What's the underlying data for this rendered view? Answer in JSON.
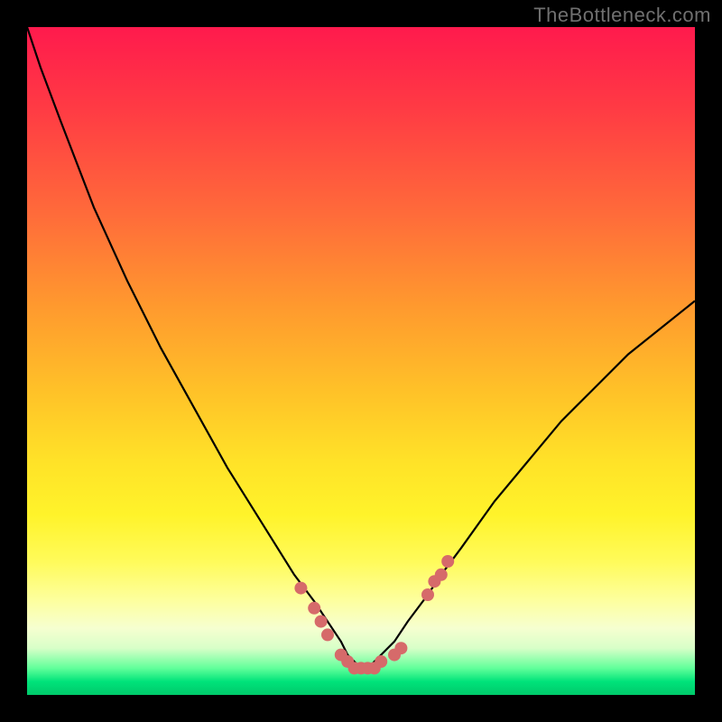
{
  "watermark": "TheBottleneck.com",
  "colors": {
    "frame": "#000000",
    "curve_stroke": "#000000",
    "marker_fill": "#d66a6a",
    "marker_stroke": "#b94d4d",
    "watermark_text": "#707070"
  },
  "chart_data": {
    "type": "line",
    "title": "",
    "xlabel": "",
    "ylabel": "",
    "xlim": [
      0,
      100
    ],
    "ylim": [
      0,
      100
    ],
    "grid": false,
    "series": [
      {
        "name": "bottleneck-curve",
        "x": [
          0,
          2,
          5,
          10,
          15,
          20,
          25,
          30,
          35,
          40,
          43,
          45,
          47,
          48,
          49,
          50,
          51,
          52,
          53,
          55,
          57,
          60,
          62,
          65,
          70,
          75,
          80,
          85,
          90,
          95,
          100
        ],
        "y": [
          0,
          6,
          14,
          27,
          38,
          48,
          57,
          66,
          74,
          82,
          86,
          89,
          92,
          94,
          95,
          96,
          96,
          95,
          94,
          92,
          89,
          85,
          82,
          78,
          71,
          65,
          59,
          54,
          49,
          45,
          41
        ]
      }
    ],
    "markers": {
      "name": "highlighted-points",
      "x": [
        41,
        43,
        44,
        45,
        47,
        48,
        49,
        50,
        51,
        52,
        53,
        55,
        56,
        60,
        61,
        62,
        63
      ],
      "y": [
        84,
        87,
        89,
        91,
        94,
        95,
        96,
        96,
        96,
        96,
        95,
        94,
        93,
        85,
        83,
        82,
        80
      ]
    }
  }
}
